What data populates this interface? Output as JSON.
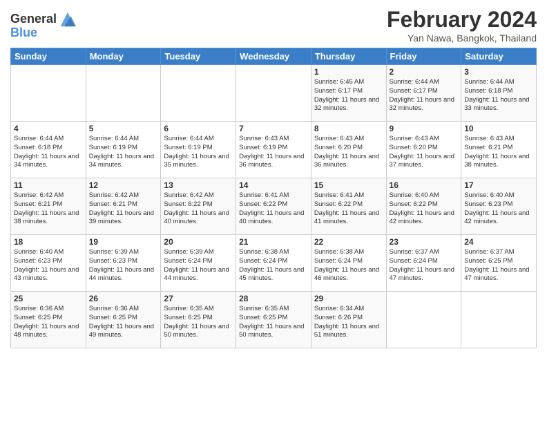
{
  "logo": {
    "line1": "General",
    "line2": "Blue"
  },
  "title": "February 2024",
  "subtitle": "Yan Nawa, Bangkok, Thailand",
  "days_of_week": [
    "Sunday",
    "Monday",
    "Tuesday",
    "Wednesday",
    "Thursday",
    "Friday",
    "Saturday"
  ],
  "weeks": [
    [
      {
        "day": "",
        "sunrise": "",
        "sunset": "",
        "daylight": ""
      },
      {
        "day": "",
        "sunrise": "",
        "sunset": "",
        "daylight": ""
      },
      {
        "day": "",
        "sunrise": "",
        "sunset": "",
        "daylight": ""
      },
      {
        "day": "",
        "sunrise": "",
        "sunset": "",
        "daylight": ""
      },
      {
        "day": "1",
        "sunrise": "Sunrise: 6:45 AM",
        "sunset": "Sunset: 6:17 PM",
        "daylight": "Daylight: 11 hours and 32 minutes."
      },
      {
        "day": "2",
        "sunrise": "Sunrise: 6:44 AM",
        "sunset": "Sunset: 6:17 PM",
        "daylight": "Daylight: 11 hours and 32 minutes."
      },
      {
        "day": "3",
        "sunrise": "Sunrise: 6:44 AM",
        "sunset": "Sunset: 6:18 PM",
        "daylight": "Daylight: 11 hours and 33 minutes."
      }
    ],
    [
      {
        "day": "4",
        "sunrise": "Sunrise: 6:44 AM",
        "sunset": "Sunset: 6:18 PM",
        "daylight": "Daylight: 11 hours and 34 minutes."
      },
      {
        "day": "5",
        "sunrise": "Sunrise: 6:44 AM",
        "sunset": "Sunset: 6:19 PM",
        "daylight": "Daylight: 11 hours and 34 minutes."
      },
      {
        "day": "6",
        "sunrise": "Sunrise: 6:44 AM",
        "sunset": "Sunset: 6:19 PM",
        "daylight": "Daylight: 11 hours and 35 minutes."
      },
      {
        "day": "7",
        "sunrise": "Sunrise: 6:43 AM",
        "sunset": "Sunset: 6:19 PM",
        "daylight": "Daylight: 11 hours and 36 minutes."
      },
      {
        "day": "8",
        "sunrise": "Sunrise: 6:43 AM",
        "sunset": "Sunset: 6:20 PM",
        "daylight": "Daylight: 11 hours and 36 minutes."
      },
      {
        "day": "9",
        "sunrise": "Sunrise: 6:43 AM",
        "sunset": "Sunset: 6:20 PM",
        "daylight": "Daylight: 11 hours and 37 minutes."
      },
      {
        "day": "10",
        "sunrise": "Sunrise: 6:43 AM",
        "sunset": "Sunset: 6:21 PM",
        "daylight": "Daylight: 11 hours and 38 minutes."
      }
    ],
    [
      {
        "day": "11",
        "sunrise": "Sunrise: 6:42 AM",
        "sunset": "Sunset: 6:21 PM",
        "daylight": "Daylight: 11 hours and 38 minutes."
      },
      {
        "day": "12",
        "sunrise": "Sunrise: 6:42 AM",
        "sunset": "Sunset: 6:21 PM",
        "daylight": "Daylight: 11 hours and 39 minutes."
      },
      {
        "day": "13",
        "sunrise": "Sunrise: 6:42 AM",
        "sunset": "Sunset: 6:22 PM",
        "daylight": "Daylight: 11 hours and 40 minutes."
      },
      {
        "day": "14",
        "sunrise": "Sunrise: 6:41 AM",
        "sunset": "Sunset: 6:22 PM",
        "daylight": "Daylight: 11 hours and 40 minutes."
      },
      {
        "day": "15",
        "sunrise": "Sunrise: 6:41 AM",
        "sunset": "Sunset: 6:22 PM",
        "daylight": "Daylight: 11 hours and 41 minutes."
      },
      {
        "day": "16",
        "sunrise": "Sunrise: 6:40 AM",
        "sunset": "Sunset: 6:22 PM",
        "daylight": "Daylight: 11 hours and 42 minutes."
      },
      {
        "day": "17",
        "sunrise": "Sunrise: 6:40 AM",
        "sunset": "Sunset: 6:23 PM",
        "daylight": "Daylight: 11 hours and 42 minutes."
      }
    ],
    [
      {
        "day": "18",
        "sunrise": "Sunrise: 6:40 AM",
        "sunset": "Sunset: 6:23 PM",
        "daylight": "Daylight: 11 hours and 43 minutes."
      },
      {
        "day": "19",
        "sunrise": "Sunrise: 6:39 AM",
        "sunset": "Sunset: 6:23 PM",
        "daylight": "Daylight: 11 hours and 44 minutes."
      },
      {
        "day": "20",
        "sunrise": "Sunrise: 6:39 AM",
        "sunset": "Sunset: 6:24 PM",
        "daylight": "Daylight: 11 hours and 44 minutes."
      },
      {
        "day": "21",
        "sunrise": "Sunrise: 6:38 AM",
        "sunset": "Sunset: 6:24 PM",
        "daylight": "Daylight: 11 hours and 45 minutes."
      },
      {
        "day": "22",
        "sunrise": "Sunrise: 6:38 AM",
        "sunset": "Sunset: 6:24 PM",
        "daylight": "Daylight: 11 hours and 46 minutes."
      },
      {
        "day": "23",
        "sunrise": "Sunrise: 6:37 AM",
        "sunset": "Sunset: 6:24 PM",
        "daylight": "Daylight: 11 hours and 47 minutes."
      },
      {
        "day": "24",
        "sunrise": "Sunrise: 6:37 AM",
        "sunset": "Sunset: 6:25 PM",
        "daylight": "Daylight: 11 hours and 47 minutes."
      }
    ],
    [
      {
        "day": "25",
        "sunrise": "Sunrise: 6:36 AM",
        "sunset": "Sunset: 6:25 PM",
        "daylight": "Daylight: 11 hours and 48 minutes."
      },
      {
        "day": "26",
        "sunrise": "Sunrise: 6:36 AM",
        "sunset": "Sunset: 6:25 PM",
        "daylight": "Daylight: 11 hours and 49 minutes."
      },
      {
        "day": "27",
        "sunrise": "Sunrise: 6:35 AM",
        "sunset": "Sunset: 6:25 PM",
        "daylight": "Daylight: 11 hours and 50 minutes."
      },
      {
        "day": "28",
        "sunrise": "Sunrise: 6:35 AM",
        "sunset": "Sunset: 6:25 PM",
        "daylight": "Daylight: 11 hours and 50 minutes."
      },
      {
        "day": "29",
        "sunrise": "Sunrise: 6:34 AM",
        "sunset": "Sunset: 6:26 PM",
        "daylight": "Daylight: 11 hours and 51 minutes."
      },
      {
        "day": "",
        "sunrise": "",
        "sunset": "",
        "daylight": ""
      },
      {
        "day": "",
        "sunrise": "",
        "sunset": "",
        "daylight": ""
      }
    ]
  ]
}
